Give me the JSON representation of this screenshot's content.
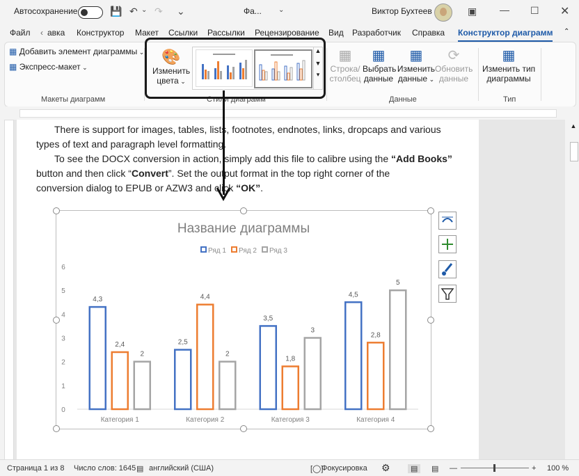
{
  "titlebar": {
    "autosave_label": "Автосохранение",
    "autosave_state": "Откл.",
    "doc_title": "Фа...",
    "user_name": "Виктор Бухтеев"
  },
  "tabs": [
    "Файл",
    "авка",
    "Конструктор",
    "Макет",
    "Ссылки",
    "Рассылки",
    "Рецензирование",
    "Вид",
    "Разработчик",
    "Справка",
    "Конструктор диаграмм"
  ],
  "ribbon": {
    "add_element": "Добавить элемент диаграммы",
    "express_layout": "Экспресс-макет",
    "group_layouts": "Макеты диаграмм",
    "change_colors_1": "Изменить",
    "change_colors_2": "цвета",
    "group_styles": "Стили диаграмм",
    "row_col_1": "Строка/",
    "row_col_2": "столбец",
    "select_data_1": "Выбрать",
    "select_data_2": "данные",
    "edit_data_1": "Изменить",
    "edit_data_2": "данные",
    "refresh_data_1": "Обновить",
    "refresh_data_2": "данные",
    "group_data": "Данные",
    "change_type_1": "Изменить тип",
    "change_type_2": "диаграммы",
    "group_type": "Тип"
  },
  "document": {
    "line1": "There is support for images, tables, lists, footnotes, endnotes, links, dropcaps and various",
    "line2": "types of text and paragraph level formatting.",
    "line3_a": "To see the DOCX conversion in action, simply add this file to calibre using the ",
    "line3_b": "“Add Books”",
    "line4_a": "button and then click “",
    "line4_b": "Convert",
    "line4_c": "”.  Set the output format in the top right corner of the",
    "line5_a": "conversion dialog to EPUB or AZW3 and click ",
    "line5_b": "“OK”",
    "line5_c": "."
  },
  "status": {
    "page": "Страница 1 из 8",
    "words": "Число слов: 1645",
    "language": "английский (США)",
    "focus": "Фокусировка",
    "zoom": "100 %"
  },
  "colors": {
    "series1": "#4472c4",
    "series2": "#ed7d31",
    "series3": "#a5a5a5",
    "accent": "#1e5aa8"
  },
  "chart_data": {
    "type": "bar",
    "title": "Название диаграммы",
    "categories": [
      "Категория 1",
      "Категория 2",
      "Категория 3",
      "Категория 4"
    ],
    "series": [
      {
        "name": "Ряд 1",
        "values": [
          4.3,
          2.5,
          3.5,
          4.5
        ],
        "labels": [
          "4,3",
          "2,5",
          "3,5",
          "4,5"
        ]
      },
      {
        "name": "Ряд 2",
        "values": [
          2.4,
          4.4,
          1.8,
          2.8
        ],
        "labels": [
          "2,4",
          "4,4",
          "1,8",
          "2,8"
        ]
      },
      {
        "name": "Ряд 3",
        "values": [
          2,
          2,
          3,
          5
        ],
        "labels": [
          "2",
          "2",
          "3",
          "5"
        ]
      }
    ],
    "ylim": [
      0,
      6
    ],
    "yticks": [
      "0",
      "1",
      "2",
      "3",
      "4",
      "5",
      "6"
    ],
    "legend": "top",
    "grid": false
  }
}
